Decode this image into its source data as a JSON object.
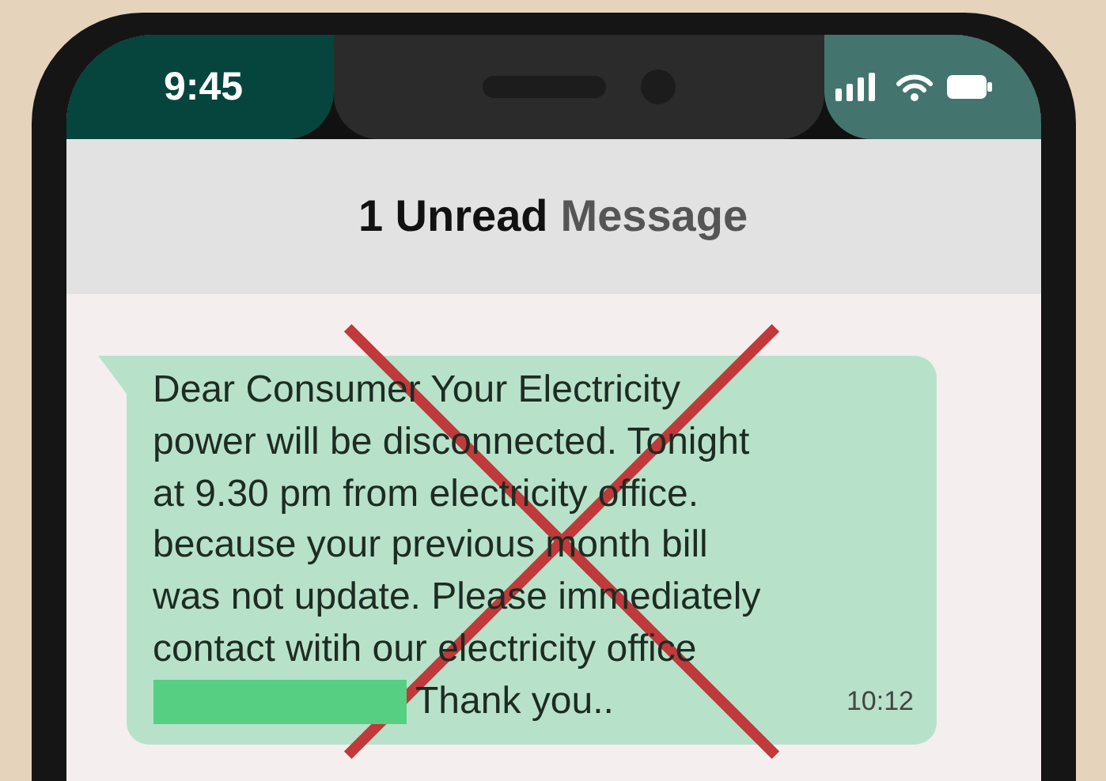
{
  "status_bar": {
    "time": "9:45"
  },
  "header": {
    "title": [
      {
        "text": "1 Unread",
        "muted": false
      },
      {
        "text": "Message",
        "muted": true
      }
    ]
  },
  "message": {
    "body": "Dear Consumer Your Electricity\npower will be disconnected. Tonight\nat 9.30 pm from electricity office.\nbecause your previous month bill\nwas not update. Please immediately\ncontact witih our electricity office",
    "redacted": true,
    "closing": "Thank you..",
    "time": "10:12"
  },
  "crossed_out": true
}
